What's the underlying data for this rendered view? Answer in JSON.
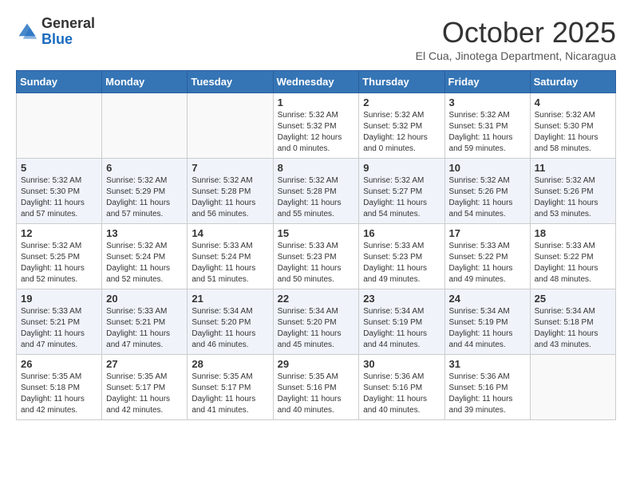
{
  "header": {
    "logo_general": "General",
    "logo_blue": "Blue",
    "month": "October 2025",
    "location": "El Cua, Jinotega Department, Nicaragua"
  },
  "weekdays": [
    "Sunday",
    "Monday",
    "Tuesday",
    "Wednesday",
    "Thursday",
    "Friday",
    "Saturday"
  ],
  "weeks": [
    [
      {
        "day": "",
        "info": ""
      },
      {
        "day": "",
        "info": ""
      },
      {
        "day": "",
        "info": ""
      },
      {
        "day": "1",
        "info": "Sunrise: 5:32 AM\nSunset: 5:32 PM\nDaylight: 12 hours\nand 0 minutes."
      },
      {
        "day": "2",
        "info": "Sunrise: 5:32 AM\nSunset: 5:32 PM\nDaylight: 12 hours\nand 0 minutes."
      },
      {
        "day": "3",
        "info": "Sunrise: 5:32 AM\nSunset: 5:31 PM\nDaylight: 11 hours\nand 59 minutes."
      },
      {
        "day": "4",
        "info": "Sunrise: 5:32 AM\nSunset: 5:30 PM\nDaylight: 11 hours\nand 58 minutes."
      }
    ],
    [
      {
        "day": "5",
        "info": "Sunrise: 5:32 AM\nSunset: 5:30 PM\nDaylight: 11 hours\nand 57 minutes."
      },
      {
        "day": "6",
        "info": "Sunrise: 5:32 AM\nSunset: 5:29 PM\nDaylight: 11 hours\nand 57 minutes."
      },
      {
        "day": "7",
        "info": "Sunrise: 5:32 AM\nSunset: 5:28 PM\nDaylight: 11 hours\nand 56 minutes."
      },
      {
        "day": "8",
        "info": "Sunrise: 5:32 AM\nSunset: 5:28 PM\nDaylight: 11 hours\nand 55 minutes."
      },
      {
        "day": "9",
        "info": "Sunrise: 5:32 AM\nSunset: 5:27 PM\nDaylight: 11 hours\nand 54 minutes."
      },
      {
        "day": "10",
        "info": "Sunrise: 5:32 AM\nSunset: 5:26 PM\nDaylight: 11 hours\nand 54 minutes."
      },
      {
        "day": "11",
        "info": "Sunrise: 5:32 AM\nSunset: 5:26 PM\nDaylight: 11 hours\nand 53 minutes."
      }
    ],
    [
      {
        "day": "12",
        "info": "Sunrise: 5:32 AM\nSunset: 5:25 PM\nDaylight: 11 hours\nand 52 minutes."
      },
      {
        "day": "13",
        "info": "Sunrise: 5:32 AM\nSunset: 5:24 PM\nDaylight: 11 hours\nand 52 minutes."
      },
      {
        "day": "14",
        "info": "Sunrise: 5:33 AM\nSunset: 5:24 PM\nDaylight: 11 hours\nand 51 minutes."
      },
      {
        "day": "15",
        "info": "Sunrise: 5:33 AM\nSunset: 5:23 PM\nDaylight: 11 hours\nand 50 minutes."
      },
      {
        "day": "16",
        "info": "Sunrise: 5:33 AM\nSunset: 5:23 PM\nDaylight: 11 hours\nand 49 minutes."
      },
      {
        "day": "17",
        "info": "Sunrise: 5:33 AM\nSunset: 5:22 PM\nDaylight: 11 hours\nand 49 minutes."
      },
      {
        "day": "18",
        "info": "Sunrise: 5:33 AM\nSunset: 5:22 PM\nDaylight: 11 hours\nand 48 minutes."
      }
    ],
    [
      {
        "day": "19",
        "info": "Sunrise: 5:33 AM\nSunset: 5:21 PM\nDaylight: 11 hours\nand 47 minutes."
      },
      {
        "day": "20",
        "info": "Sunrise: 5:33 AM\nSunset: 5:21 PM\nDaylight: 11 hours\nand 47 minutes."
      },
      {
        "day": "21",
        "info": "Sunrise: 5:34 AM\nSunset: 5:20 PM\nDaylight: 11 hours\nand 46 minutes."
      },
      {
        "day": "22",
        "info": "Sunrise: 5:34 AM\nSunset: 5:20 PM\nDaylight: 11 hours\nand 45 minutes."
      },
      {
        "day": "23",
        "info": "Sunrise: 5:34 AM\nSunset: 5:19 PM\nDaylight: 11 hours\nand 44 minutes."
      },
      {
        "day": "24",
        "info": "Sunrise: 5:34 AM\nSunset: 5:19 PM\nDaylight: 11 hours\nand 44 minutes."
      },
      {
        "day": "25",
        "info": "Sunrise: 5:34 AM\nSunset: 5:18 PM\nDaylight: 11 hours\nand 43 minutes."
      }
    ],
    [
      {
        "day": "26",
        "info": "Sunrise: 5:35 AM\nSunset: 5:18 PM\nDaylight: 11 hours\nand 42 minutes."
      },
      {
        "day": "27",
        "info": "Sunrise: 5:35 AM\nSunset: 5:17 PM\nDaylight: 11 hours\nand 42 minutes."
      },
      {
        "day": "28",
        "info": "Sunrise: 5:35 AM\nSunset: 5:17 PM\nDaylight: 11 hours\nand 41 minutes."
      },
      {
        "day": "29",
        "info": "Sunrise: 5:35 AM\nSunset: 5:16 PM\nDaylight: 11 hours\nand 40 minutes."
      },
      {
        "day": "30",
        "info": "Sunrise: 5:36 AM\nSunset: 5:16 PM\nDaylight: 11 hours\nand 40 minutes."
      },
      {
        "day": "31",
        "info": "Sunrise: 5:36 AM\nSunset: 5:16 PM\nDaylight: 11 hours\nand 39 minutes."
      },
      {
        "day": "",
        "info": ""
      }
    ]
  ]
}
